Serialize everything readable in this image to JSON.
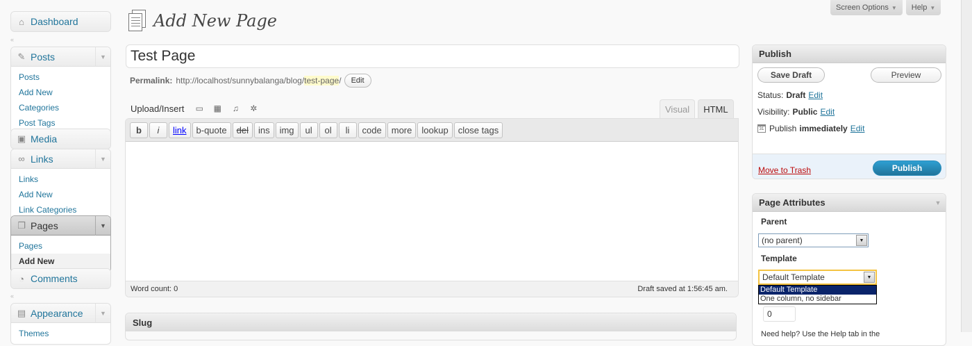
{
  "header": {
    "screen_options": "Screen Options",
    "help": "Help"
  },
  "sidebar": {
    "dashboard": "Dashboard",
    "posts": {
      "label": "Posts",
      "items": [
        "Posts",
        "Add New",
        "Categories",
        "Post Tags"
      ]
    },
    "media": "Media",
    "links": {
      "label": "Links",
      "items": [
        "Links",
        "Add New",
        "Link Categories"
      ]
    },
    "pages": {
      "label": "Pages",
      "items": [
        "Pages",
        "Add New"
      ]
    },
    "comments": "Comments",
    "appearance": {
      "label": "Appearance",
      "items": [
        "Themes"
      ]
    }
  },
  "main": {
    "page_title": "Add New Page",
    "title_value": "Test Page",
    "permalink": {
      "label": "Permalink:",
      "base": "http://localhost/sunnybalanga/blog/",
      "slug": "test-page",
      "trail": "/",
      "edit_label": "Edit"
    },
    "upload_label": "Upload/Insert",
    "tabs": {
      "visual": "Visual",
      "html": "HTML"
    },
    "quicktags": [
      "b",
      "i",
      "link",
      "b-quote",
      "del",
      "ins",
      "img",
      "ul",
      "ol",
      "li",
      "code",
      "more",
      "lookup",
      "close tags"
    ],
    "word_count": "Word count: 0",
    "draft_saved": "Draft saved at 1:56:45 am.",
    "slug_box_title": "Slug"
  },
  "publish": {
    "title": "Publish",
    "save_draft": "Save Draft",
    "preview": "Preview",
    "status_label": "Status:",
    "status_value": "Draft",
    "visibility_label": "Visibility:",
    "visibility_value": "Public",
    "publish_label": "Publish",
    "publish_value": "immediately",
    "edit": "Edit",
    "move_to_trash": "Move to Trash",
    "publish_button": "Publish"
  },
  "attributes": {
    "title": "Page Attributes",
    "parent_label": "Parent",
    "parent_value": "(no parent)",
    "template_label": "Template",
    "template_value": "Default Template",
    "template_options": [
      "Default Template",
      "One column, no sidebar"
    ],
    "order_value": "0",
    "help_text": "Need help? Use the Help tab in the"
  }
}
